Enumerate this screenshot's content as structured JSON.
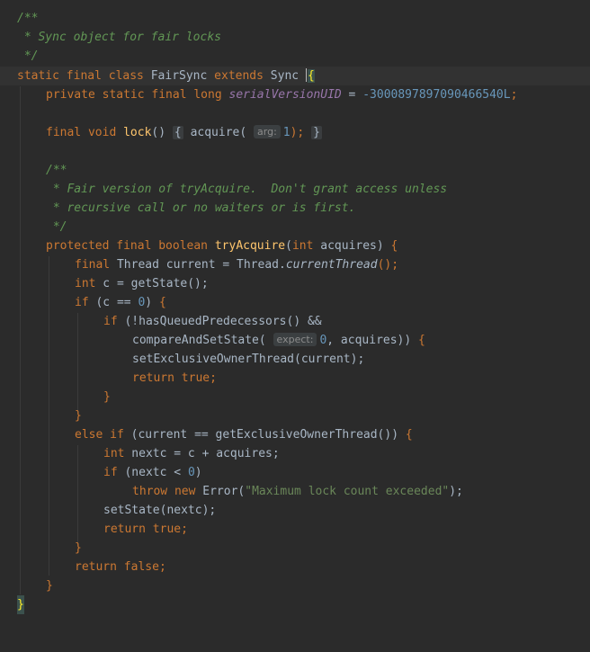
{
  "colors": {
    "background": "#2b2b2b",
    "doc_comment": "#629755",
    "keyword": "#cc7832",
    "function": "#ffc66d",
    "number": "#6897bb",
    "string": "#6a8759",
    "constant_field": "#9876aa",
    "text": "#a9b7c6"
  },
  "code": {
    "l1": {
      "doc": "/**"
    },
    "l2": {
      "doc": " * Sync object for fair locks"
    },
    "l3": {
      "doc": " */"
    },
    "l4": {
      "kw1": "static final class",
      "name": "FairSync",
      "kw2": "extends",
      "super": "Sync",
      "brace": "{"
    },
    "l5": {
      "kw": "private static final long",
      "field": "serialVersionUID",
      "eq": " = ",
      "value": "-3000897897090466540L",
      "semi": ";"
    },
    "l7": {
      "kw": "final void",
      "fn": "lock",
      "parens": "()",
      "fold_open": "{",
      "call": "acquire",
      "paren_open": "(",
      "hint": "arg:",
      "arg": "1",
      "close": ");",
      "fold_close": "}"
    },
    "l9": {
      "doc": "/**"
    },
    "l10": {
      "doc": " * Fair version of tryAcquire.  Don't grant access unless"
    },
    "l11": {
      "doc": " * recursive call or no waiters or is first."
    },
    "l12": {
      "doc": " */"
    },
    "l13": {
      "kw": "protected final boolean",
      "fn": "tryAcquire",
      "paren_open": "(",
      "ptype": "int",
      "pname": "acquires",
      "paren_close": ")",
      "brace": "{"
    },
    "l14": {
      "kw": "final",
      "text": " Thread current = Thread.",
      "static_call": "currentThread",
      "end": "();"
    },
    "l15": {
      "kw": "int",
      "text": " c = getState();"
    },
    "l16": {
      "kw": "if",
      "text1": " (c == ",
      "num": "0",
      "text2": ") ",
      "brace": "{"
    },
    "l17": {
      "kw": "if",
      "text": " (!hasQueuedPredecessors() &&"
    },
    "l18": {
      "text1": "compareAndSetState(",
      "hint": "expect:",
      "num": "0",
      "text2": ", acquires)) ",
      "brace": "{"
    },
    "l19": {
      "text": "setExclusiveOwnerThread(current);"
    },
    "l20": {
      "kw": "return",
      "val": "true",
      "semi": ";"
    },
    "l21": {
      "brace": "}"
    },
    "l22": {
      "brace": "}"
    },
    "l23": {
      "kw": "else if",
      "text": " (current == getExclusiveOwnerThread()) ",
      "brace": "{"
    },
    "l24": {
      "kw": "int",
      "text": " nextc = c + acquires;"
    },
    "l25": {
      "kw": "if",
      "text1": " (nextc < ",
      "num": "0",
      "text2": ")"
    },
    "l26": {
      "kw1": "throw",
      "kw2": "new",
      "text1": " Error(",
      "str": "\"Maximum lock count exceeded\"",
      "text2": ");"
    },
    "l27": {
      "text": "setState(nextc);"
    },
    "l28": {
      "kw": "return",
      "val": "true",
      "semi": ";"
    },
    "l29": {
      "brace": "}"
    },
    "l30": {
      "kw": "return",
      "val": "false",
      "semi": ";"
    },
    "l31": {
      "brace": "}"
    },
    "l32": {
      "brace": "}"
    }
  }
}
